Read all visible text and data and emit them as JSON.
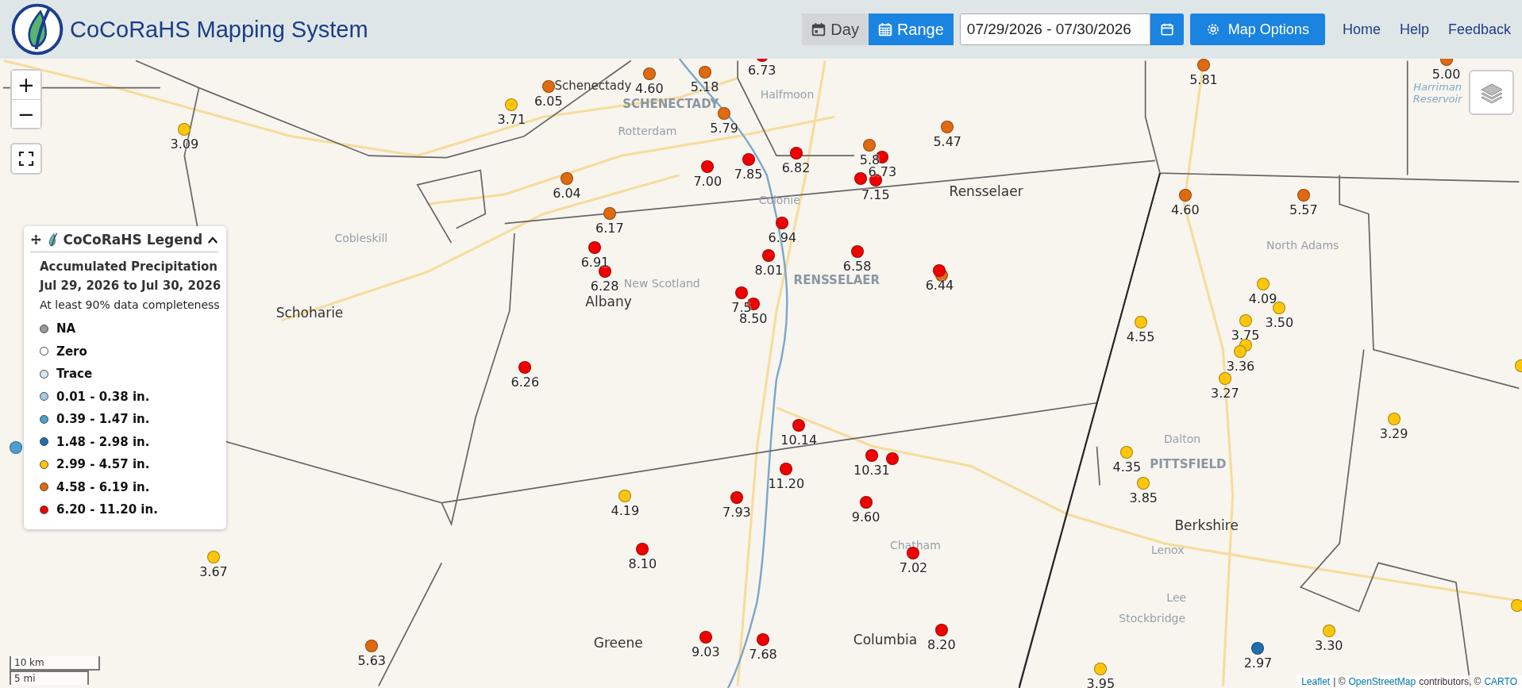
{
  "header": {
    "title": "CoCoRaHS Mapping System",
    "tabs": [
      {
        "label": "Day",
        "selected": false
      },
      {
        "label": "Range",
        "selected": true
      }
    ],
    "date_range": {
      "value": "07/29/2026 - 07/30/2026"
    },
    "map_options": "Map Options",
    "nav": [
      "Home",
      "Help",
      "Feedback"
    ]
  },
  "map": {
    "controls": {
      "zoom_in": "+",
      "zoom_out": "−"
    },
    "places": [
      {
        "name": "Schenectady",
        "kind": "town"
      },
      {
        "name": "SCHENECTADY",
        "kind": "city"
      },
      {
        "name": "Rotterdam",
        "kind": "minor"
      },
      {
        "name": "Halfmoon",
        "kind": "minor"
      },
      {
        "name": "Colonie",
        "kind": "minor"
      },
      {
        "name": "Rensselaer",
        "kind": "county"
      },
      {
        "name": "RENSSELAER",
        "kind": "city"
      },
      {
        "name": "New Scotland",
        "kind": "minor"
      },
      {
        "name": "Albany",
        "kind": "county"
      },
      {
        "name": "Schoharie",
        "kind": "county"
      },
      {
        "name": "Cobleskill",
        "kind": "minor"
      },
      {
        "name": "North Adams",
        "kind": "minor"
      },
      {
        "name": "Harriman Reservoir",
        "kind": "water"
      },
      {
        "name": "Dalton",
        "kind": "minor"
      },
      {
        "name": "PITTSFIELD",
        "kind": "city"
      },
      {
        "name": "Berkshire",
        "kind": "county"
      },
      {
        "name": "Lenox",
        "kind": "minor"
      },
      {
        "name": "Lee",
        "kind": "minor"
      },
      {
        "name": "Stockbridge",
        "kind": "minor"
      },
      {
        "name": "Chatham",
        "kind": "minor"
      },
      {
        "name": "Columbia",
        "kind": "county"
      },
      {
        "name": "Greene",
        "kind": "county"
      }
    ],
    "markers": [
      {
        "value": "6.05",
        "color": "#e06a10"
      },
      {
        "value": "4.60",
        "color": "#e06a10"
      },
      {
        "value": "5.18",
        "color": "#e06a10"
      },
      {
        "value": "6.73",
        "color": "#f00000"
      },
      {
        "value": "3.71",
        "color": "#ffc60a"
      },
      {
        "value": "3.09",
        "color": "#ffc60a"
      },
      {
        "value": "5.79",
        "color": "#e06a10"
      },
      {
        "value": "5.47",
        "color": "#e06a10"
      },
      {
        "value": "5.81",
        "color": "#e06a10"
      },
      {
        "value": "5.00",
        "color": "#e06a10"
      },
      {
        "value": "7.00",
        "color": "#f00000"
      },
      {
        "value": "7.85",
        "color": "#f00000"
      },
      {
        "value": "6.82",
        "color": "#f00000"
      },
      {
        "value": "5.8",
        "color": "#e06a10"
      },
      {
        "value": "6.73",
        "color": "#f00000"
      },
      {
        "color": "#f00000"
      },
      {
        "value": "7.15",
        "color": "#f00000"
      },
      {
        "value": "6.04",
        "color": "#e06a10"
      },
      {
        "value": "6.17",
        "color": "#e06a10"
      },
      {
        "value": "6.94",
        "color": "#f00000"
      },
      {
        "value": "6.91",
        "color": "#f00000"
      },
      {
        "value": "6.28",
        "color": "#f00000"
      },
      {
        "value": "8.01",
        "color": "#f00000"
      },
      {
        "value": "6.58",
        "color": "#f00000"
      },
      {
        "color": "#e06a10"
      },
      {
        "value": "6.44",
        "color": "#f00000"
      },
      {
        "value": "7.5",
        "color": "#f00000"
      },
      {
        "value": "8.50",
        "color": "#f00000"
      },
      {
        "value": "6.26",
        "color": "#f00000"
      },
      {
        "color": "#4aa0d0"
      },
      {
        "value": "4.60",
        "color": "#e06a10"
      },
      {
        "value": "5.57",
        "color": "#e06a10"
      },
      {
        "value": "4.09",
        "color": "#ffc60a"
      },
      {
        "value": "4.55",
        "color": "#ffc60a"
      },
      {
        "value": "3.75",
        "color": "#ffc60a"
      },
      {
        "value": "3.50",
        "color": "#ffc60a"
      },
      {
        "color": "#ffc60a"
      },
      {
        "value": "3.36",
        "color": "#ffc60a"
      },
      {
        "value": "3.27",
        "color": "#ffc60a"
      },
      {
        "color": "#ffc60a"
      },
      {
        "value": "3.29",
        "color": "#ffc60a"
      },
      {
        "value": "10.14",
        "color": "#f00000"
      },
      {
        "value": "10.31",
        "color": "#f00000"
      },
      {
        "color": "#f00000"
      },
      {
        "value": "11.20",
        "color": "#f00000"
      },
      {
        "value": "4.35",
        "color": "#ffc60a"
      },
      {
        "value": "3.85",
        "color": "#ffc60a"
      },
      {
        "value": "4.19",
        "color": "#ffc60a"
      },
      {
        "value": "7.93",
        "color": "#f00000"
      },
      {
        "value": "9.60",
        "color": "#f00000"
      },
      {
        "value": "8.10",
        "color": "#f00000"
      },
      {
        "value": "7.02",
        "color": "#f00000"
      },
      {
        "value": "3.67",
        "color": "#ffc60a"
      },
      {
        "value": "8.20",
        "color": "#f00000"
      },
      {
        "value": "9.03",
        "color": "#f00000"
      },
      {
        "value": "7.68",
        "color": "#f00000"
      },
      {
        "value": "5.63",
        "color": "#e06a10"
      },
      {
        "value": "2.97",
        "color": "#1f6fb0"
      },
      {
        "value": "3.30",
        "color": "#ffc60a"
      },
      {
        "value": "3.95",
        "color": "#ffc60a"
      },
      {
        "color": "#ffc60a"
      }
    ],
    "legend": {
      "title": "CoCoRaHS Legend",
      "heading": "Accumulated Precipitation",
      "period": "Jul 29, 2026 to Jul 30, 2026",
      "note": "At least 90% data completeness",
      "items": [
        {
          "label": "NA",
          "color": "#999999"
        },
        {
          "label": "Zero",
          "color": "#ffffff"
        },
        {
          "label": "Trace",
          "color": "#d6e6f4"
        },
        {
          "label": "0.01 - 0.38 in.",
          "color": "#a6cbe3"
        },
        {
          "label": "0.39 - 1.47 in.",
          "color": "#4aa0d0"
        },
        {
          "label": "1.48 - 2.98 in.",
          "color": "#1f6fb0"
        },
        {
          "label": "2.99 - 4.57 in.",
          "color": "#ffc60a"
        },
        {
          "label": "4.58 - 6.19 in.",
          "color": "#e06a10"
        },
        {
          "label": "6.20 - 11.20 in.",
          "color": "#f00000"
        }
      ]
    },
    "scale": [
      "10 km",
      "5 mi"
    ],
    "attribution": {
      "leaflet": "Leaflet",
      "sep": "| ©",
      "osm": "OpenStreetMap",
      "mid": "contributors, ©",
      "carto": "CARTO"
    }
  }
}
